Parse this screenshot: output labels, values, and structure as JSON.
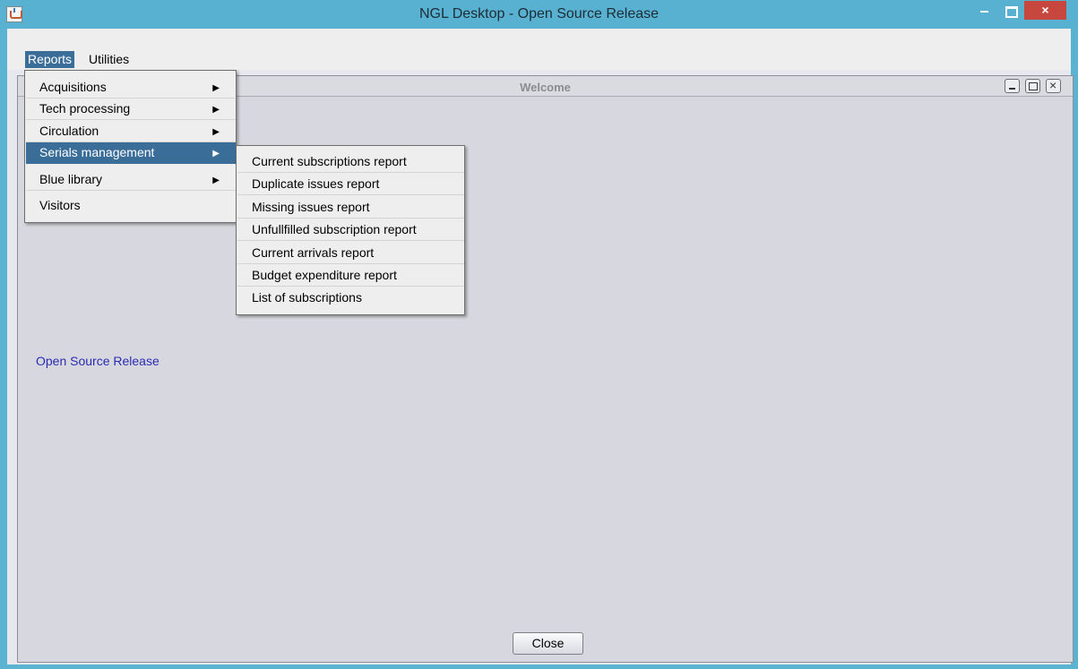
{
  "window": {
    "title": "NGL Desktop - Open Source Release",
    "close_glyph": "×",
    "accent_color": "#5bb3d2",
    "close_color": "#c7463e"
  },
  "menubar": {
    "reports": "Reports",
    "utilities": "Utilities"
  },
  "reports_menu": {
    "items": [
      {
        "label": "Acquisitions",
        "arrow": "▶"
      },
      {
        "label": "Tech processing",
        "arrow": "▶"
      },
      {
        "label": "Circulation",
        "arrow": "▶"
      },
      {
        "label": "Serials management",
        "arrow": "▶"
      },
      {
        "label": "Blue library",
        "arrow": "▶"
      },
      {
        "label": "Visitors"
      }
    ],
    "selected": "Serials management",
    "selection_color": "#3b6d99"
  },
  "serials_submenu": {
    "items": [
      "Current subscriptions report",
      "Duplicate issues report",
      "Missing issues report",
      "Unfullfilled subscription report",
      "Current arrivals report",
      "Budget expenditure report",
      "List of subscriptions"
    ]
  },
  "welcome_frame": {
    "title": "Welcome",
    "release_text": "Open Source Release",
    "close_button": "Close"
  },
  "icons": {
    "app": "java-cup-icon",
    "minimize": "minimize-icon",
    "maximize": "maximize-icon",
    "close": "close-icon"
  }
}
